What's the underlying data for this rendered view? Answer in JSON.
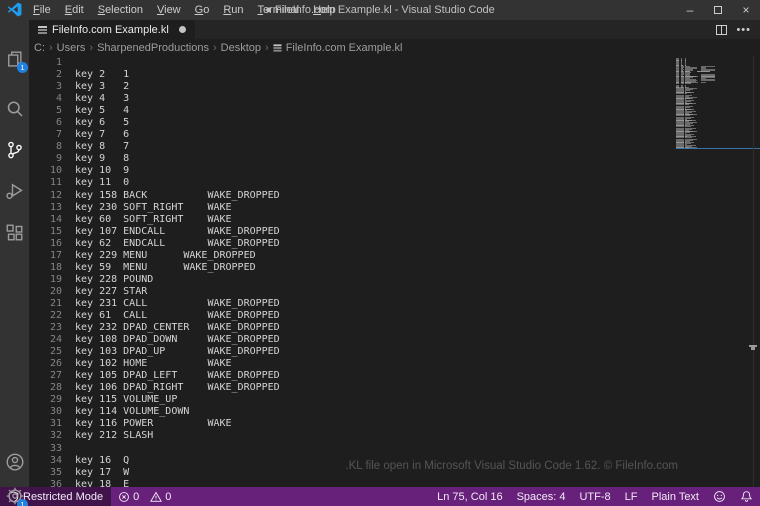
{
  "window": {
    "title": "● FileInfo.com Example.kl - Visual Studio Code",
    "menu": [
      "File",
      "Edit",
      "Selection",
      "View",
      "Go",
      "Run",
      "Terminal",
      "Help"
    ],
    "controls": {
      "minimize": "–",
      "maximize": "",
      "close": "×"
    }
  },
  "activity_bar": {
    "top": [
      {
        "name": "explorer",
        "badge": "1",
        "active": false
      },
      {
        "name": "search",
        "active": false
      },
      {
        "name": "source-control",
        "active": true
      },
      {
        "name": "run-debug",
        "active": false
      },
      {
        "name": "extensions",
        "active": false
      }
    ],
    "bottom": [
      {
        "name": "account"
      },
      {
        "name": "settings",
        "badge": "1"
      }
    ]
  },
  "tab_bar": {
    "tabs": [
      {
        "label": "FileInfo.com Example.kl",
        "modified": true,
        "active": true
      }
    ]
  },
  "breadcrumb": {
    "segments": [
      "C:",
      "Users",
      "SharpenedProductions",
      "Desktop"
    ],
    "file": "FileInfo.com Example.kl"
  },
  "editor": {
    "lines": [
      "",
      "key 2   1",
      "key 3   2",
      "key 4   3",
      "key 5   4",
      "key 6   5",
      "key 7   6",
      "key 8   7",
      "key 9   8",
      "key 10  9",
      "key 11  0",
      "key 158 BACK          WAKE_DROPPED",
      "key 230 SOFT_RIGHT    WAKE",
      "key 60  SOFT_RIGHT    WAKE",
      "key 107 ENDCALL       WAKE_DROPPED",
      "key 62  ENDCALL       WAKE_DROPPED",
      "key 229 MENU      WAKE_DROPPED",
      "key 59  MENU      WAKE_DROPPED",
      "key 228 POUND",
      "key 227 STAR",
      "key 231 CALL          WAKE_DROPPED",
      "key 61  CALL          WAKE_DROPPED",
      "key 232 DPAD_CENTER   WAKE_DROPPED",
      "key 108 DPAD_DOWN     WAKE_DROPPED",
      "key 103 DPAD_UP       WAKE_DROPPED",
      "key 102 HOME          WAKE",
      "key 105 DPAD_LEFT     WAKE_DROPPED",
      "key 106 DPAD_RIGHT    WAKE_DROPPED",
      "key 115 VOLUME_UP",
      "key 114 VOLUME_DOWN",
      "key 116 POWER         WAKE",
      "key 212 SLASH",
      "",
      "key 16  Q",
      "key 17  W",
      "key 18  E"
    ],
    "watermark": ".KL file open in Microsoft Visual Studio Code 1.62. © FileInfo.com"
  },
  "minimap": {
    "total_rows": 109
  },
  "status_bar": {
    "restricted_mode": "Restricted Mode",
    "errors": "0",
    "warnings": "0",
    "right": [
      "Ln 75, Col 16",
      "Spaces: 4",
      "UTF-8",
      "LF",
      "Plain Text"
    ]
  },
  "colors": {
    "status_bar": "#68217a",
    "badge": "#2080e0",
    "logo_blue": "#1f9cf0",
    "minimap_slider_edge": "#3a73a8"
  }
}
